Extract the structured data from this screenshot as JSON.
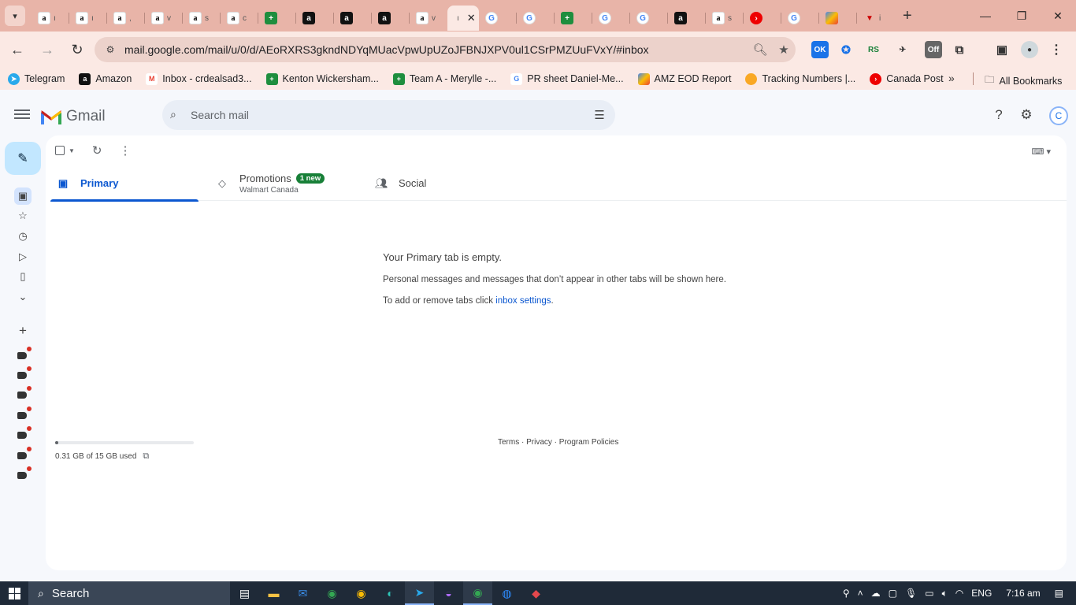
{
  "browser": {
    "tab_titles": [
      "a ı",
      "a ı",
      "a ,",
      "a v",
      "a s",
      "a c",
      "",
      "a",
      "a",
      "a",
      "a v",
      "ı",
      "",
      "",
      "",
      "",
      "",
      "a",
      "a s",
      "s",
      "",
      "",
      "i"
    ],
    "url": "mail.google.com/mail/u/0/d/AEoRXRS3gkndNDYqMUacVpwUpUZoJFBNJXPV0ul1CSrPMZUuFVxY/#inbox",
    "ext_ok_label": "OK",
    "ext_off_label": "Off",
    "ext_rs_label": "RS",
    "bookmarks": [
      "Telegram",
      "Amazon",
      "Inbox - crdealsad3...",
      "Kenton Wickersham...",
      "Team A - Merylle -...",
      "PR sheet Daniel-Me...",
      "AMZ EOD Report",
      "Tracking Numbers |...",
      "Canada Post"
    ],
    "all_bookmarks": "All Bookmarks"
  },
  "gmail": {
    "logo_text": "Gmail",
    "search_placeholder": "Search mail",
    "avatar_initial": "C",
    "tabs": {
      "primary": "Primary",
      "promotions": "Promotions",
      "promotions_badge": "1 new",
      "promotions_sub": "Walmart Canada",
      "social": "Social"
    },
    "empty": {
      "heading": "Your Primary tab is empty.",
      "line1": "Personal messages and messages that don’t appear in other tabs will be shown here.",
      "line2_prefix": "To add or remove tabs click ",
      "line2_link": "inbox settings",
      "line2_suffix": "."
    },
    "storage": {
      "text": "0.31 GB of 15 GB used",
      "used_fraction": 0.021
    },
    "footer": "Terms · Privacy · Program Policies"
  },
  "taskbar": {
    "search_label": "Search",
    "language": "ENG",
    "time": "7:16 am"
  },
  "colors": {
    "tab_strip": "#e8b4a8",
    "compose_bg": "#c2e7ff",
    "accent": "#0b57d0",
    "badge": "#188038"
  }
}
